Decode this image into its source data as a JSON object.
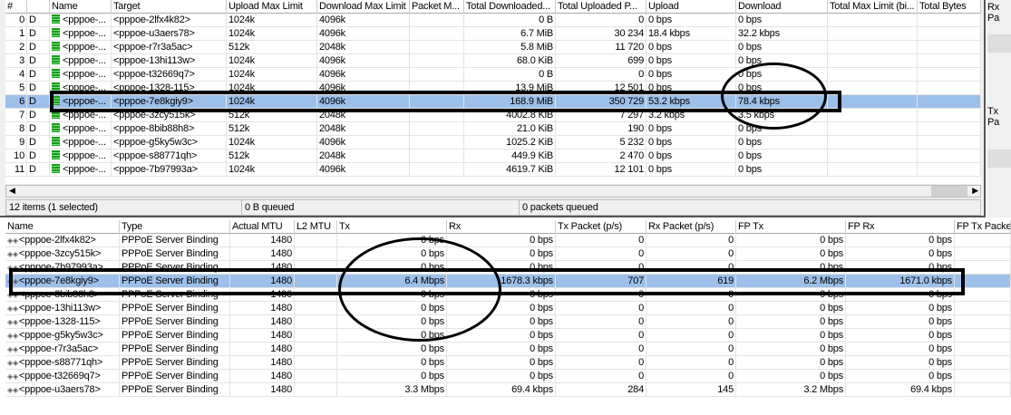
{
  "queue_window": {
    "columns": [
      "#",
      "",
      "Name",
      "Target",
      "Upload Max Limit",
      "Download Max Limit",
      "Packet M...",
      "Total Downloaded...",
      "Total Uploaded P...",
      "Upload",
      "Download",
      "Total Max Limit (bi...",
      "Total Bytes"
    ],
    "rows": [
      [
        "0",
        "D",
        "<pppoe-...",
        "<pppoe-2lfx4k82>",
        "1024k",
        "4096k",
        "",
        "0 B",
        "0",
        "0 bps",
        "0 bps",
        "",
        ""
      ],
      [
        "1",
        "D",
        "<pppoe-...",
        "<pppoe-u3aers78>",
        "1024k",
        "4096k",
        "",
        "6.7 MiB",
        "30 234",
        "18.4 kbps",
        "32.2 kbps",
        "",
        ""
      ],
      [
        "2",
        "D",
        "<pppoe-...",
        "<pppoe-r7r3a5ac>",
        "512k",
        "2048k",
        "",
        "5.8 MiB",
        "11 720",
        "0 bps",
        "0 bps",
        "",
        ""
      ],
      [
        "3",
        "D",
        "<pppoe-...",
        "<pppoe-13hi113w>",
        "1024k",
        "4096k",
        "",
        "68.0 KiB",
        "699",
        "0 bps",
        "0 bps",
        "",
        ""
      ],
      [
        "4",
        "D",
        "<pppoe-...",
        "<pppoe-t32669q7>",
        "1024k",
        "4096k",
        "",
        "0 B",
        "0",
        "0 bps",
        "0 bps",
        "",
        ""
      ],
      [
        "5",
        "D",
        "<pppoe-...",
        "<pppoe-1328-115>",
        "1024k",
        "4096k",
        "",
        "13.9 MiB",
        "12 501",
        "0 bps",
        "0 bps",
        "",
        ""
      ],
      [
        "6",
        "D",
        "<pppoe-...",
        "<pppoe-7e8kgiy9>",
        "1024k",
        "4096k",
        "",
        "168.9 MiB",
        "350 729",
        "53.2 kbps",
        "78.4 kbps",
        "",
        ""
      ],
      [
        "7",
        "D",
        "<pppoe-...",
        "<pppoe-3zcy515k>",
        "512k",
        "2048k",
        "",
        "4002.8 KiB",
        "7 297",
        "3.2 kbps",
        "3.5 kbps",
        "",
        ""
      ],
      [
        "8",
        "D",
        "<pppoe-...",
        "<pppoe-8bib88h8>",
        "512k",
        "2048k",
        "",
        "21.0 KiB",
        "190",
        "0 bps",
        "0 bps",
        "",
        ""
      ],
      [
        "9",
        "D",
        "<pppoe-...",
        "<pppoe-g5ky5w3c>",
        "1024k",
        "4096k",
        "",
        "1025.2 KiB",
        "5 232",
        "0 bps",
        "0 bps",
        "",
        ""
      ],
      [
        "10",
        "D",
        "<pppoe-...",
        "<pppoe-s88771qh>",
        "512k",
        "2048k",
        "",
        "449.9 KiB",
        "2 470",
        "0 bps",
        "0 bps",
        "",
        ""
      ],
      [
        "11",
        "D",
        "<pppoe-...",
        "<pppoe-7b97993a>",
        "1024k",
        "4096k",
        "",
        "4619.7 KiB",
        "12 101",
        "0 bps",
        "0 bps",
        "",
        ""
      ]
    ],
    "selected_index": 6,
    "status": {
      "items": "12 items (1 selected)",
      "bytes_queued": "0 B queued",
      "packets_queued": "0 packets queued"
    },
    "side_labels": [
      "Rx Pa",
      "Tx Pa"
    ]
  },
  "interfaces": {
    "columns": [
      "Name",
      "Type",
      "Actual MTU",
      "L2 MTU",
      "Tx",
      "Rx",
      "Tx Packet (p/s)",
      "Rx Packet (p/s)",
      "FP Tx",
      "FP Rx",
      "FP Tx Packe"
    ],
    "rows": [
      [
        "<pppoe-2lfx4k82>",
        "PPPoE Server Binding",
        "1480",
        "",
        "0 bps",
        "0 bps",
        "0",
        "0",
        "0 bps",
        "0 bps",
        ""
      ],
      [
        "<pppoe-3zcy515k>",
        "PPPoE Server Binding",
        "1480",
        "",
        "0 bps",
        "0 bps",
        "0",
        "0",
        "0 bps",
        "0 bps",
        ""
      ],
      [
        "<pppoe-7b97993a>",
        "PPPoE Server Binding",
        "1480",
        "",
        "0 bps",
        "0 bps",
        "0",
        "0",
        "0 bps",
        "0 bps",
        ""
      ],
      [
        "<pppoe-7e8kgiy9>",
        "PPPoE Server Binding",
        "1480",
        "",
        "6.4 Mbps",
        "1678.3 kbps",
        "707",
        "619",
        "6.2 Mbps",
        "1671.0 kbps",
        ""
      ],
      [
        "<pppoe-8bib88h8>",
        "PPPoE Server Binding",
        "1480",
        "",
        "0 bps",
        "0 bps",
        "0",
        "0",
        "0 bps",
        "0 bps",
        ""
      ],
      [
        "<pppoe-13hi113w>",
        "PPPoE Server Binding",
        "1480",
        "",
        "0 bps",
        "0 bps",
        "0",
        "0",
        "0 bps",
        "0 bps",
        ""
      ],
      [
        "<pppoe-1328-115>",
        "PPPoE Server Binding",
        "1480",
        "",
        "0 bps",
        "0 bps",
        "0",
        "0",
        "0 bps",
        "0 bps",
        ""
      ],
      [
        "<pppoe-g5ky5w3c>",
        "PPPoE Server Binding",
        "1480",
        "",
        "0 bps",
        "0 bps",
        "0",
        "0",
        "0 bps",
        "0 bps",
        ""
      ],
      [
        "<pppoe-r7r3a5ac>",
        "PPPoE Server Binding",
        "1480",
        "",
        "0 bps",
        "0 bps",
        "0",
        "0",
        "0 bps",
        "0 bps",
        ""
      ],
      [
        "<pppoe-s88771qh>",
        "PPPoE Server Binding",
        "1480",
        "",
        "0 bps",
        "0 bps",
        "0",
        "0",
        "0 bps",
        "0 bps",
        ""
      ],
      [
        "<pppoe-t32669q7>",
        "PPPoE Server Binding",
        "1480",
        "",
        "0 bps",
        "0 bps",
        "0",
        "0",
        "0 bps",
        "0 bps",
        ""
      ],
      [
        "<pppoe-u3aers78>",
        "PPPoE Server Binding",
        "1480",
        "",
        "3.3 Mbps",
        "69.4 kbps",
        "284",
        "145",
        "3.2 Mbps",
        "69.4 kbps",
        ""
      ]
    ],
    "selected_index": 3
  },
  "colors": {
    "selection": "#9dc0ea",
    "annotation": "#000000"
  }
}
